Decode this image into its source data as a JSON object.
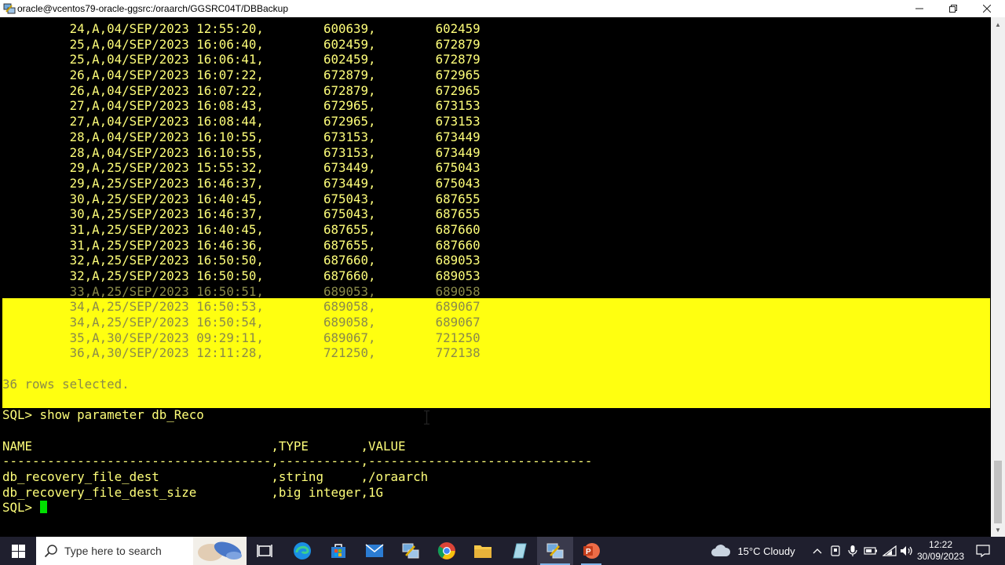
{
  "window": {
    "title": "oracle@vcentos79-oracle-ggsrc:/oraarch/GGSRC04T/DBBackup",
    "controls": [
      "minimize",
      "restore",
      "close"
    ]
  },
  "terminal": {
    "rows": [
      "         24,A,04/SEP/2023 12:55:20,        600639,        602459",
      "         25,A,04/SEP/2023 16:06:40,        602459,        672879",
      "         25,A,04/SEP/2023 16:06:41,        602459,        672879",
      "         26,A,04/SEP/2023 16:07:22,        672879,        672965",
      "         26,A,04/SEP/2023 16:07:22,        672879,        672965",
      "         27,A,04/SEP/2023 16:08:43,        672965,        673153",
      "         27,A,04/SEP/2023 16:08:44,        672965,        673153",
      "         28,A,04/SEP/2023 16:10:55,        673153,        673449",
      "         28,A,04/SEP/2023 16:10:55,        673153,        673449",
      "         29,A,25/SEP/2023 15:55:32,        673449,        675043",
      "         29,A,25/SEP/2023 16:46:37,        673449,        675043",
      "         30,A,25/SEP/2023 16:40:45,        675043,        687655",
      "         30,A,25/SEP/2023 16:46:37,        675043,        687655",
      "         31,A,25/SEP/2023 16:40:45,        687655,        687660",
      "         31,A,25/SEP/2023 16:46:36,        687655,        687660",
      "         32,A,25/SEP/2023 16:50:50,        687660,        689053",
      "         32,A,25/SEP/2023 16:50:50,        687660,        689053",
      "         33,A,25/SEP/2023 16:50:51,        689053,        689058"
    ],
    "selected_rows": [
      "         33,A,25/SEP/2023 16:50:51,        689053,        689058",
      "         34,A,25/SEP/2023 16:50:53,        689058,        689067",
      "         34,A,25/SEP/2023 16:50:54,        689058,        689067",
      "         35,A,30/SEP/2023 09:29:11,        689067,        721250",
      "         36,A,30/SEP/2023 12:11:28,        721250,        772138"
    ],
    "selected_blank": "",
    "rows_selected": "36 rows selected.",
    "blank": "",
    "command": "SQL> show parameter db_Reco",
    "header": "NAME                                ,TYPE       ,VALUE",
    "separator": "------------------------------------,-----------,------------------------------",
    "params": [
      "db_recovery_file_dest               ,string     ,/oraarch",
      "db_recovery_file_dest_size          ,big integer,1G"
    ],
    "prompt": "SQL> ",
    "colors": {
      "text": "#ffff7a",
      "selection": "#ffff10",
      "cursor": "#00e000",
      "background": "#000000"
    }
  },
  "taskbar": {
    "search_placeholder": "Type here to search",
    "apps": [
      "task-view-icon",
      "edge-icon",
      "store-icon",
      "mail-icon",
      "putty-icon",
      "chrome-icon",
      "file-explorer-icon",
      "notepad-icon",
      "putty-active-icon",
      "powerpoint-icon"
    ],
    "weather": "15°C  Cloudy",
    "time": "12:22",
    "date": "30/09/2023"
  }
}
